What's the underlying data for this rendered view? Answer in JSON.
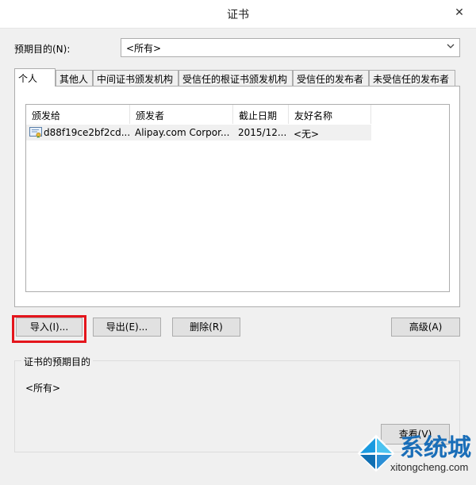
{
  "window": {
    "title": "证书",
    "close_glyph": "✕"
  },
  "purpose": {
    "label": "预期目的(N):",
    "selected": "<所有>"
  },
  "tabs": [
    {
      "label": "个人",
      "active": true
    },
    {
      "label": "其他人"
    },
    {
      "label": "中间证书颁发机构"
    },
    {
      "label": "受信任的根证书颁发机构"
    },
    {
      "label": "受信任的发布者"
    },
    {
      "label": "未受信任的发布者"
    }
  ],
  "list": {
    "columns": [
      "颁发给",
      "颁发者",
      "截止日期",
      "友好名称"
    ],
    "rows": [
      {
        "issued_to": "d88f19ce2bf2cd...",
        "issuer": "Alipay.com Corpor...",
        "expires": "2015/12...",
        "friendly_name": "<无>",
        "icon": "certificate-icon"
      }
    ]
  },
  "buttons": {
    "import": "导入(I)...",
    "export": "导出(E)...",
    "remove": "删除(R)",
    "advanced": "高级(A)",
    "view": "查看(V)"
  },
  "cert_purposes": {
    "label": "证书的预期目的",
    "value": "<所有>"
  },
  "watermark": {
    "brand": "系统城",
    "url": "xitongcheng.com"
  },
  "colors": {
    "highlight": "#e4151c",
    "accent": "#1a6eb8"
  }
}
